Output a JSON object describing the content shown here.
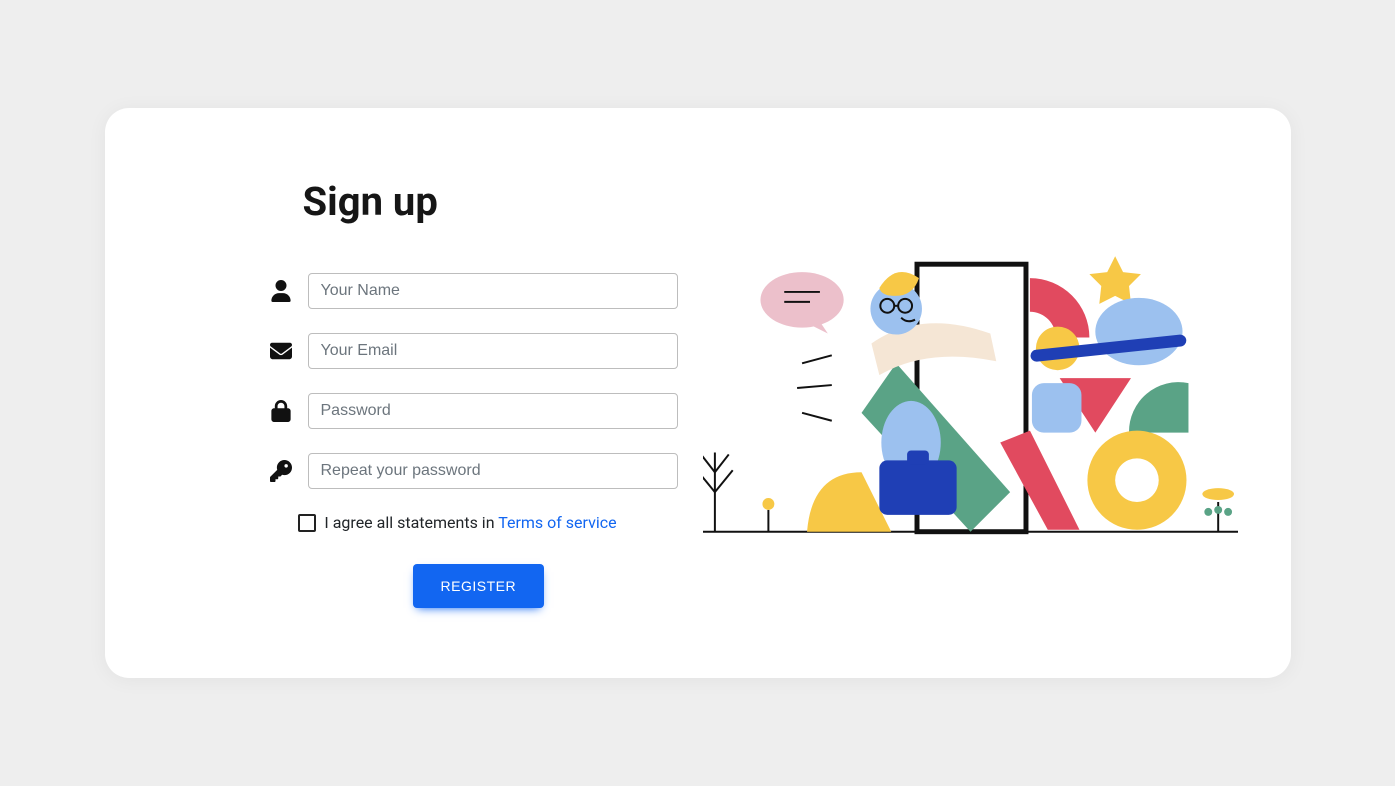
{
  "title": "Sign up",
  "form": {
    "name_placeholder": "Your Name",
    "email_placeholder": "Your Email",
    "password_placeholder": "Password",
    "repeat_password_placeholder": "Repeat your password"
  },
  "agree": {
    "prefix": "I agree all statements in ",
    "link_label": "Terms of service"
  },
  "register_label": "Register",
  "colors": {
    "primary": "#1266f1",
    "yellow": "#f7c846",
    "red": "#e14a5f",
    "green": "#5aa386",
    "lightblue": "#9cc1ef",
    "darkblue": "#1f3fb5",
    "pink": "#ecc0cb",
    "skin": "#f5e6d5"
  }
}
